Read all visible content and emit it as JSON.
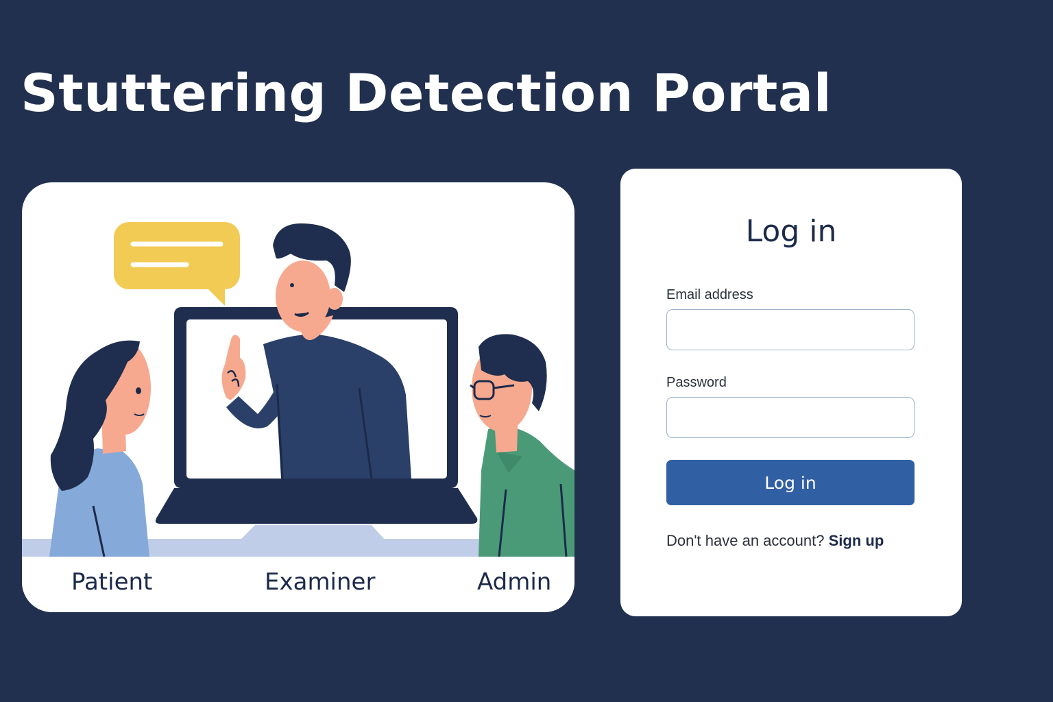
{
  "page": {
    "title": "Stuttering Detection Portal"
  },
  "illustration": {
    "roles": [
      "Patient",
      "Examiner",
      "Admin"
    ],
    "colors": {
      "background": "#22304f",
      "speech_bubble": "#f2cb54",
      "laptop": "#1f2d4e",
      "examiner_shirt": "#2b4068",
      "patient_shirt": "#85a9d8",
      "admin_shirt": "#4a9a78",
      "skin": "#f6a98f",
      "desk": "#bfcde8"
    }
  },
  "login": {
    "heading": "Log in",
    "email_label": "Email address",
    "email_value": "",
    "password_label": "Password",
    "password_value": "",
    "submit_label": "Log in",
    "signup_prompt": "Don't have an account?",
    "signup_link": "Sign up",
    "colors": {
      "button": "#315fa3",
      "input_border": "#9fb2cc"
    }
  }
}
